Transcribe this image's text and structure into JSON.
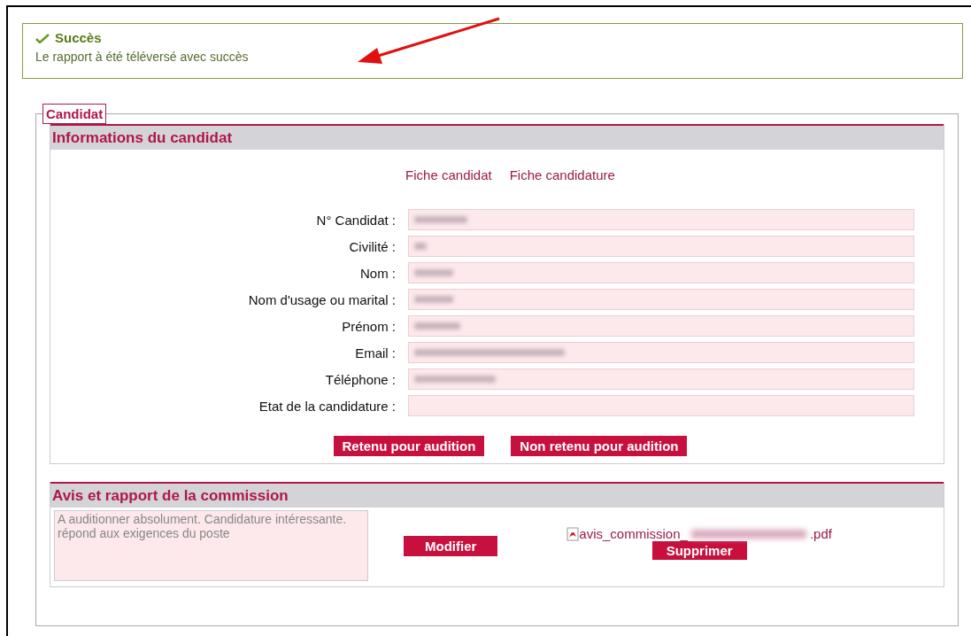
{
  "alert": {
    "kind": "success",
    "title": "Succès",
    "message": "Le rapport à été téléversé avec succès"
  },
  "annotation": {
    "kind": "arrow"
  },
  "fieldset": {
    "legend": "Candidat"
  },
  "info_section": {
    "title": "Informations du candidat",
    "links": [
      "Fiche candidat",
      "Fiche candidature"
    ],
    "fields": [
      {
        "label": "N° Candidat :",
        "blurred": true
      },
      {
        "label": "Civilité :",
        "blurred": true
      },
      {
        "label": "Nom :",
        "blurred": true
      },
      {
        "label": "Nom d'usage ou marital :",
        "blurred": true
      },
      {
        "label": "Prénom :",
        "blurred": true
      },
      {
        "label": "Email :",
        "blurred": true
      },
      {
        "label": "Téléphone :",
        "blurred": true
      },
      {
        "label": "Etat de la candidature :",
        "blurred": false
      }
    ],
    "buttons": [
      "Retenu pour audition",
      "Non retenu pour audition"
    ]
  },
  "report_section": {
    "title": "Avis et rapport de la commission",
    "comment": "A auditionner absolument. Candidature intéressante. répond aux exigences du poste",
    "edit_button": "Modifier",
    "file": {
      "name_start": "avis_commission_",
      "name_blurred": true,
      "name_end": ".pdf"
    },
    "delete_button": "Supprimer"
  }
}
